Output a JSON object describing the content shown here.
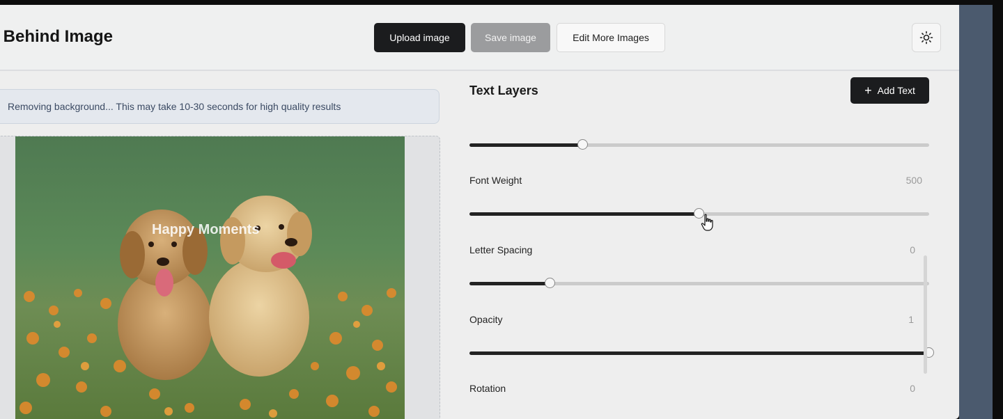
{
  "header": {
    "title": "t Behind Image",
    "upload_label": "Upload image",
    "save_label": "Save image",
    "edit_more_label": "Edit More Images",
    "theme_icon": "sun-icon"
  },
  "notice": {
    "text": "Removing background... This may take 10-30 seconds for high quality results"
  },
  "canvas": {
    "overlay_text": "Happy Moments"
  },
  "panel": {
    "title": "Text Layers",
    "add_text_label": "Add Text",
    "add_icon": "plus-icon",
    "sliders": [
      {
        "label": "",
        "value": "",
        "level": 0.247
      },
      {
        "label": "Font Weight",
        "value": "500",
        "level": 0.5
      },
      {
        "label": "Letter Spacing",
        "value": "0",
        "level": 0.176
      },
      {
        "label": "Opacity",
        "value": "1",
        "level": 1.0
      },
      {
        "label": "Rotation",
        "value": "0",
        "level": null
      }
    ]
  },
  "colors": {
    "primary_button": "#1b1c1e",
    "disabled_button": "#9b9c9e",
    "notice_bg": "#e4e8ee",
    "notice_text": "#3b4a63"
  }
}
